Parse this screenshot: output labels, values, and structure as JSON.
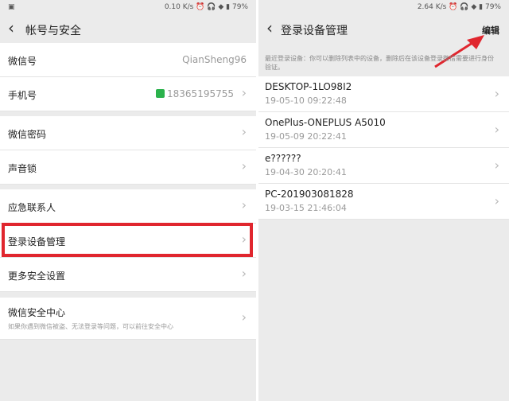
{
  "left": {
    "status": {
      "carrier_icon": "image-icon",
      "speed": "0.10 K/s",
      "icons": "⏰ 🎧 ◆ ▮",
      "battery": "79%"
    },
    "title": "帐号与安全",
    "rows": [
      {
        "label": "微信号",
        "value": "QianSheng96"
      },
      {
        "label": "手机号",
        "value": "18365195755"
      },
      {
        "label": "微信密码"
      },
      {
        "label": "声音锁"
      },
      {
        "label": "应急联系人"
      },
      {
        "label": "登录设备管理"
      },
      {
        "label": "更多安全设置"
      },
      {
        "label": "微信安全中心",
        "sub": "如果你遇到微信被盗、无法登录等问题，可以前往安全中心"
      }
    ]
  },
  "right": {
    "status": {
      "speed": "2.64 K/s",
      "icons": "⏰ 🎧 ◆ ▮",
      "battery": "79%"
    },
    "title": "登录设备管理",
    "edit_label": "编辑",
    "hint": "最近登录设备：你可以删除列表中的设备，删除后在该设备登录微信需要进行身份验证。",
    "devices": [
      {
        "name": "DESKTOP-1LO98I2",
        "time": "19-05-10 09:22:48"
      },
      {
        "name": "OnePlus-ONEPLUS A5010",
        "time": "19-05-09 20:22:41"
      },
      {
        "name": "e??????",
        "time": "19-04-30 20:20:41"
      },
      {
        "name": "PC-201903081828",
        "time": "19-03-15 21:46:04"
      }
    ]
  },
  "colors": {
    "highlight": "#e0262e",
    "lock": "#2bb24c"
  }
}
